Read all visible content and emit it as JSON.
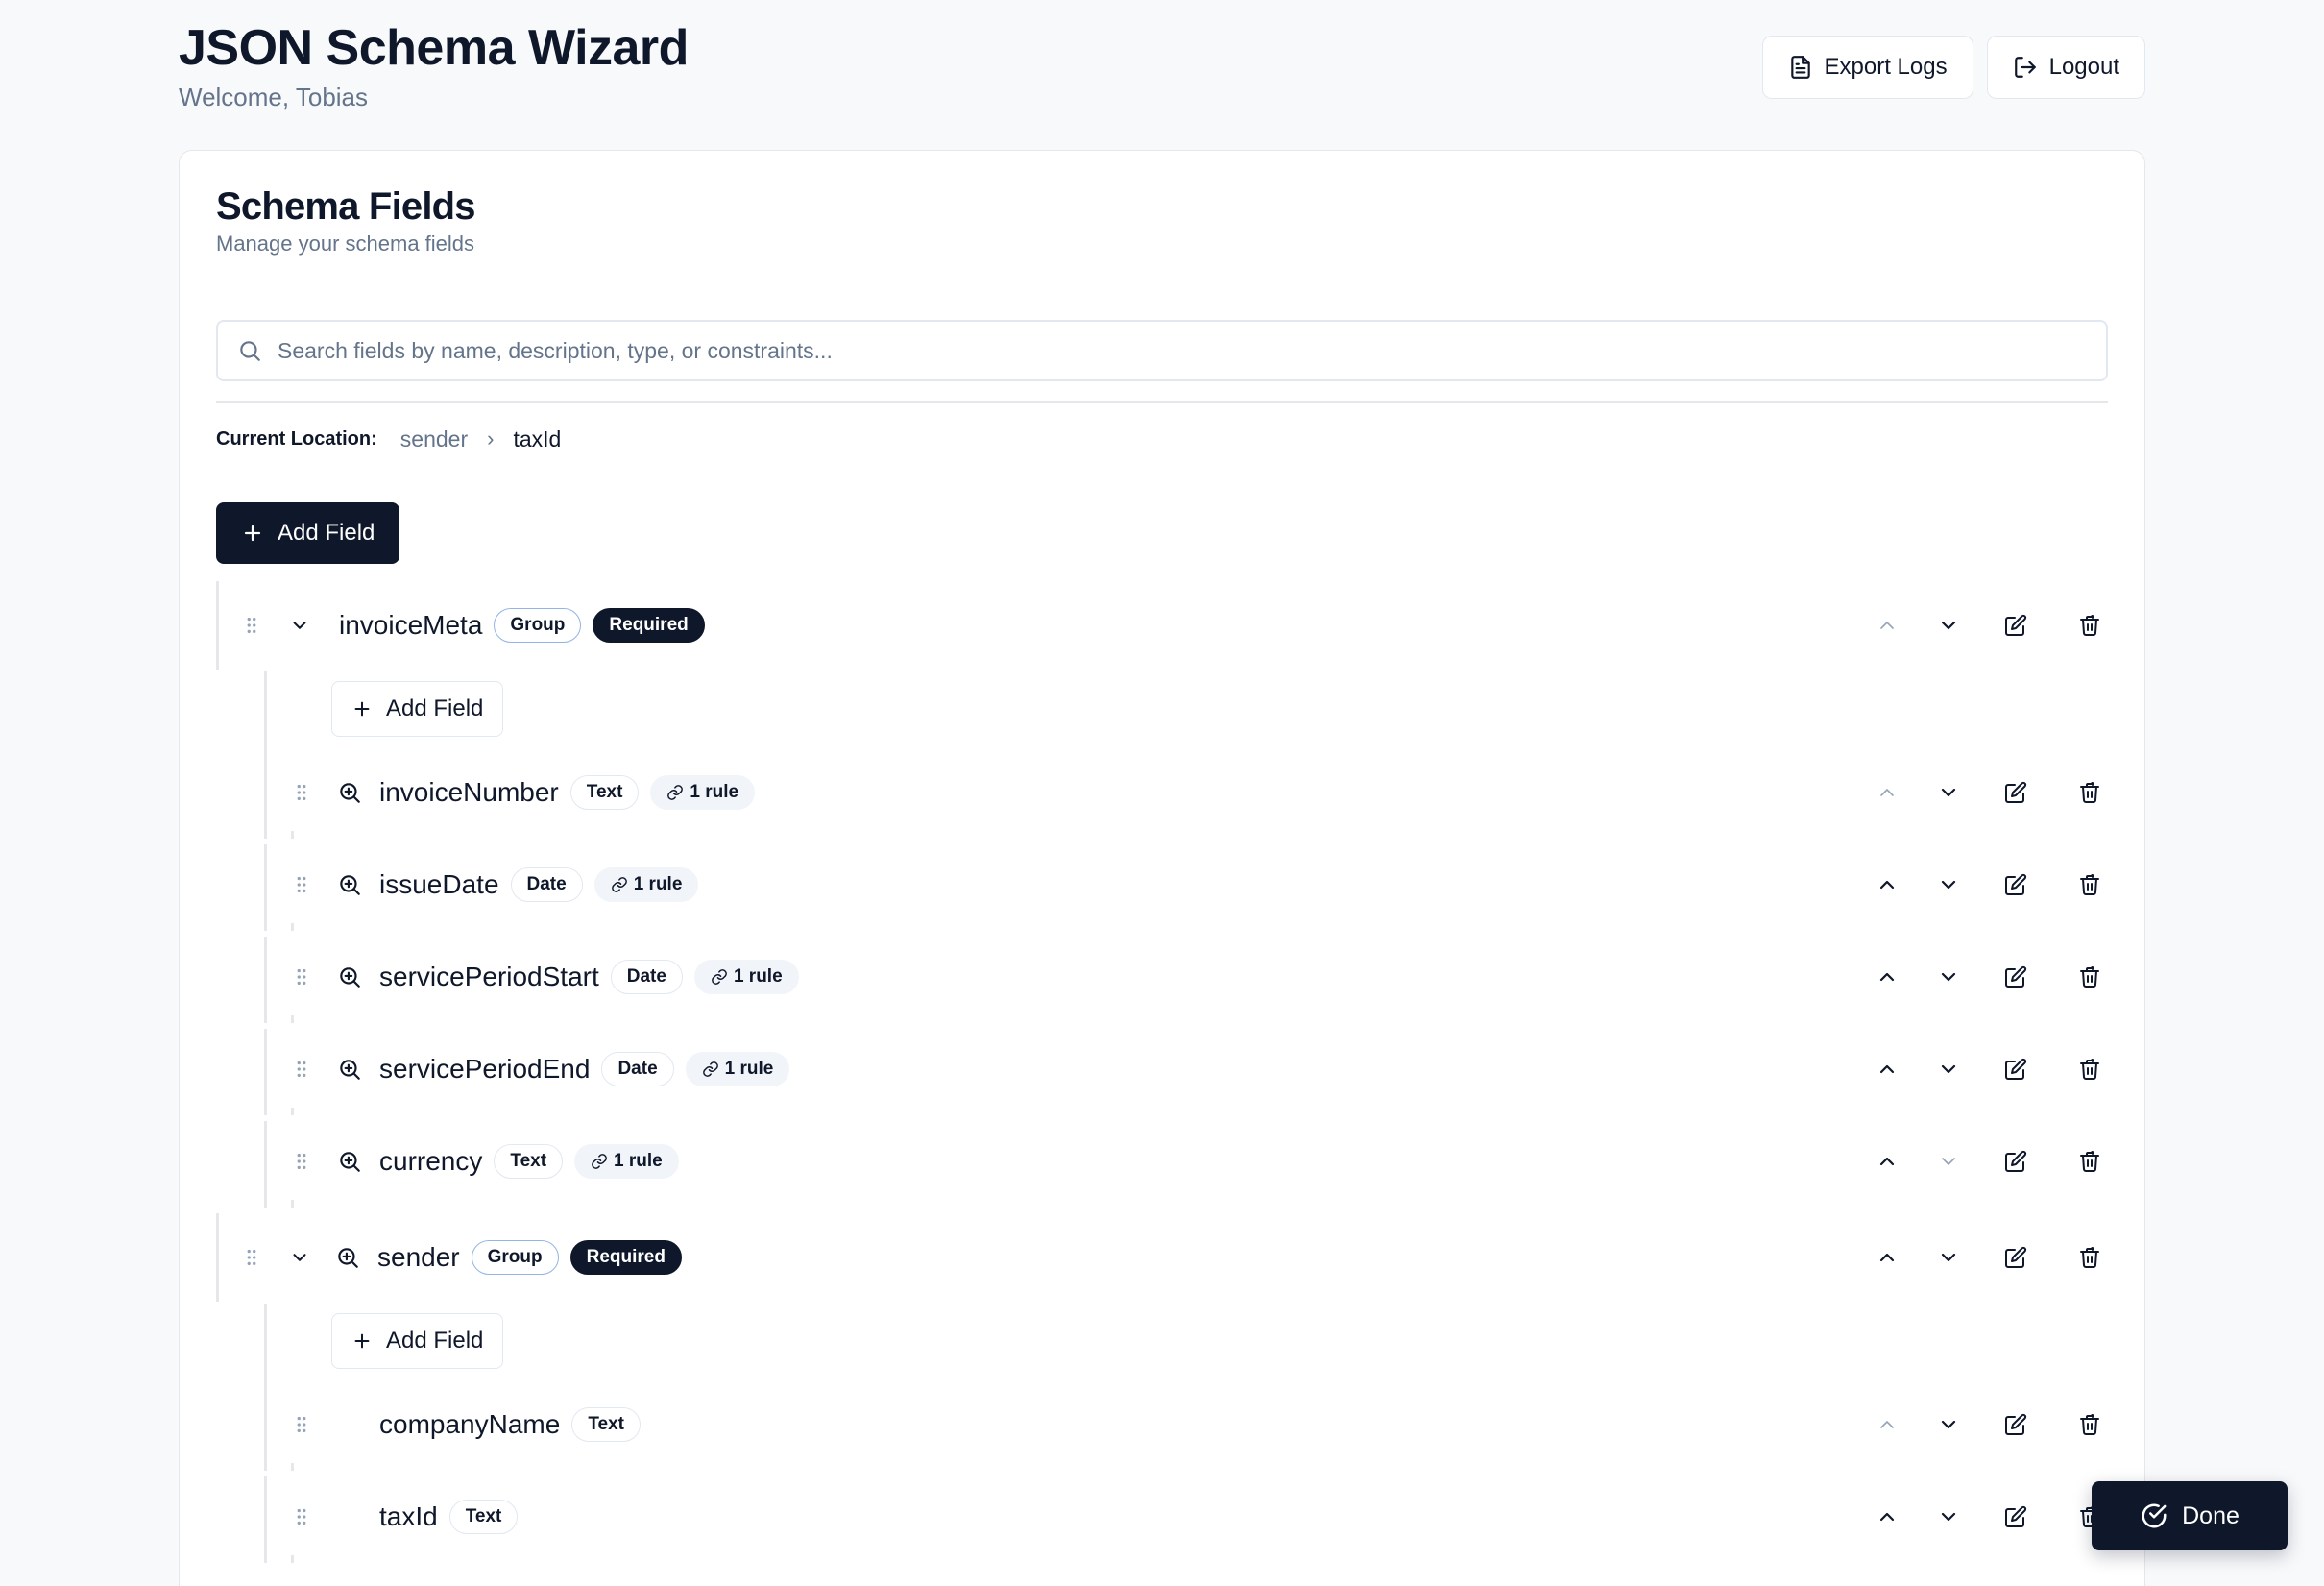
{
  "app": {
    "title": "JSON Schema Wizard",
    "welcome": "Welcome, Tobias"
  },
  "header_actions": {
    "export_label": "Export Logs",
    "logout_label": "Logout"
  },
  "card": {
    "title": "Schema Fields",
    "subtitle": "Manage your schema fields"
  },
  "search": {
    "placeholder": "Search fields by name, description, type, or constraints...",
    "value": ""
  },
  "location": {
    "label": "Current Location:",
    "crumbs": [
      "sender",
      "taxId"
    ]
  },
  "add_field_label": "Add Field",
  "done_label": "Done",
  "colors": {
    "primary": "#0f172a",
    "muted": "#64748b",
    "group_border": "#93b4e6",
    "rule_bg": "#f1f5f9"
  },
  "fields": [
    {
      "name": "invoiceMeta",
      "type": "Group",
      "required": true,
      "expanded": true,
      "level": 0,
      "up_disabled": true,
      "down_disabled": false,
      "children": [
        {
          "name": "invoiceNumber",
          "type": "Text",
          "rules": "1 rule",
          "level": 1,
          "up_disabled": true,
          "down_disabled": false
        },
        {
          "name": "issueDate",
          "type": "Date",
          "rules": "1 rule",
          "level": 1,
          "up_disabled": false,
          "down_disabled": false
        },
        {
          "name": "servicePeriodStart",
          "type": "Date",
          "rules": "1 rule",
          "level": 1,
          "up_disabled": false,
          "down_disabled": false
        },
        {
          "name": "servicePeriodEnd",
          "type": "Date",
          "rules": "1 rule",
          "level": 1,
          "up_disabled": false,
          "down_disabled": false
        },
        {
          "name": "currency",
          "type": "Text",
          "rules": "1 rule",
          "level": 1,
          "up_disabled": false,
          "down_disabled": true
        }
      ]
    },
    {
      "name": "sender",
      "type": "Group",
      "required": true,
      "expanded": true,
      "level": 0,
      "has_zoom": true,
      "up_disabled": false,
      "down_disabled": false,
      "children": [
        {
          "name": "companyName",
          "type": "Text",
          "level": 1,
          "up_disabled": true,
          "down_disabled": false
        },
        {
          "name": "taxId",
          "type": "Text",
          "level": 1,
          "up_disabled": false,
          "down_disabled": false
        }
      ]
    }
  ],
  "labels": {
    "required": "Required"
  }
}
